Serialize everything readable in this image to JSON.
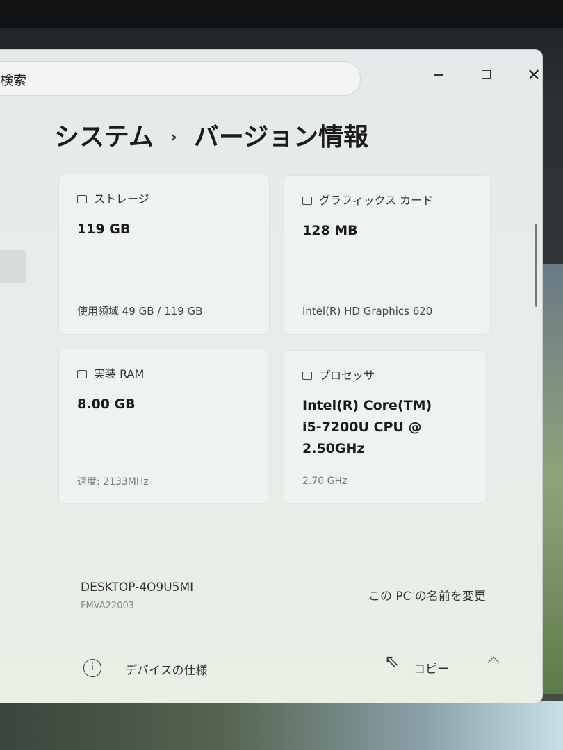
{
  "search": {
    "label": "検索"
  },
  "window_controls": {
    "minimize": "",
    "maximize": "",
    "close": "✕"
  },
  "breadcrumb": {
    "parent": "システム",
    "separator": "›",
    "current": "バージョン情報"
  },
  "cards": {
    "storage": {
      "title": "ストレージ",
      "value": "119 GB",
      "detail": "使用領域 49 GB / 119 GB",
      "icon": "drive-icon"
    },
    "graphics": {
      "title": "グラフィックス カード",
      "value": "128 MB",
      "detail": "Intel(R) HD Graphics 620",
      "icon": "gpu-icon"
    },
    "ram": {
      "title": "実装 RAM",
      "value": "8.00 GB",
      "detail": "速度: 2133MHz",
      "icon": "ram-icon"
    },
    "processor": {
      "title": "プロセッサ",
      "value_lines": [
        "Intel(R) Core(TM)",
        "i5-7200U CPU @",
        "2.50GHz"
      ],
      "detail": "2.70 GHz",
      "icon": "cpu-icon"
    }
  },
  "device": {
    "name": "DESKTOP-4O9U5MI",
    "model": "FMVA22003",
    "rename_label": "この PC の名前を変更"
  },
  "specs_section": {
    "info_glyph": "i",
    "label": "デバイスの仕様",
    "copy_label": "コピー"
  }
}
